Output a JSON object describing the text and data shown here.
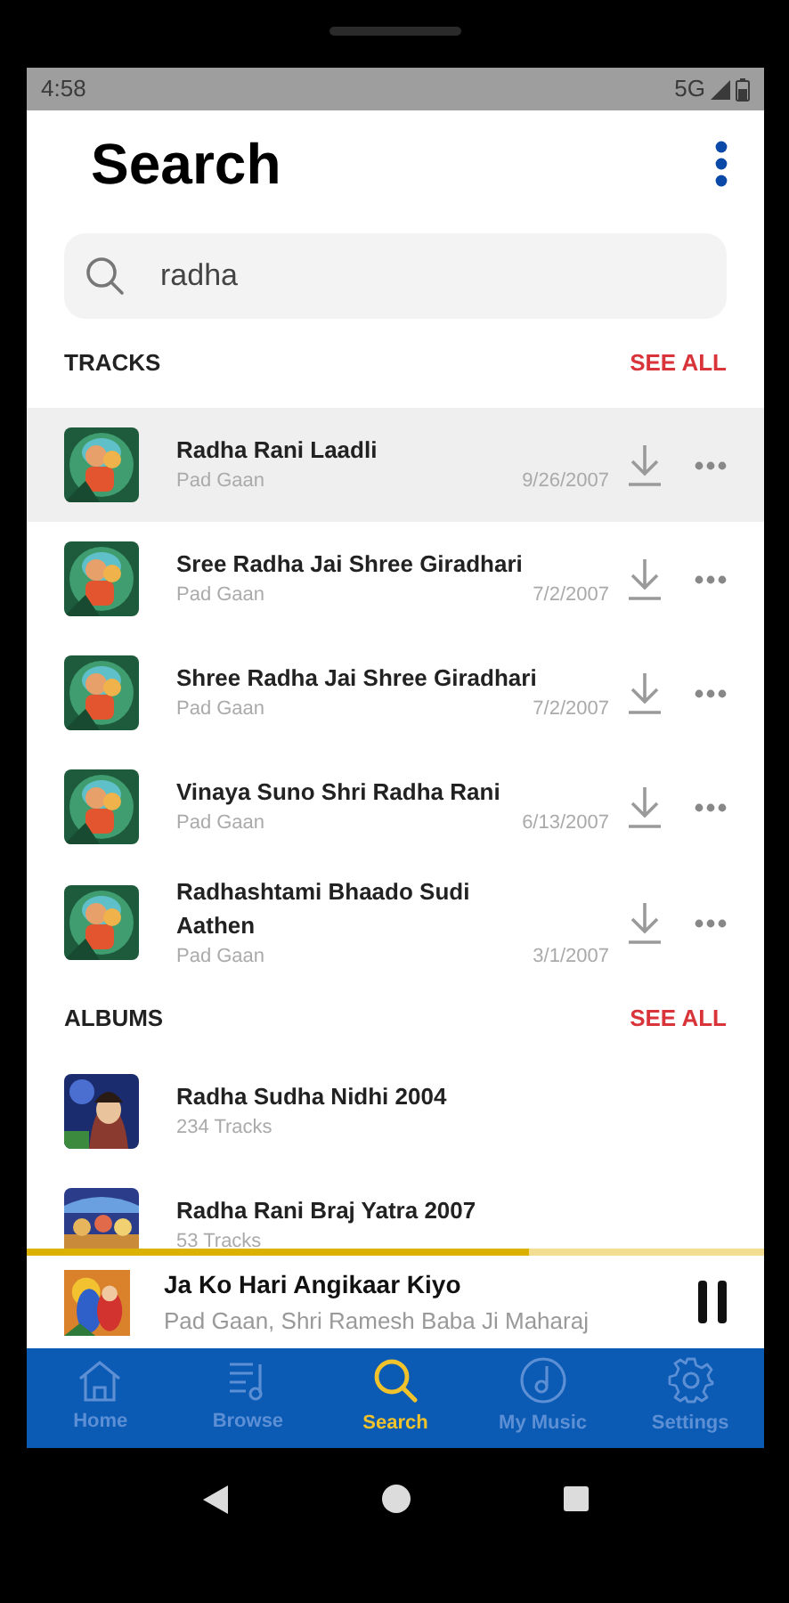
{
  "status_bar": {
    "time": "4:58",
    "network": "5G"
  },
  "header": {
    "title": "Search"
  },
  "search": {
    "value": "radha"
  },
  "tracks_section": {
    "title": "TRACKS",
    "see_all": "SEE ALL"
  },
  "tracks": [
    {
      "title": "Radha Rani Laadli",
      "subtitle": "Pad Gaan",
      "date": "9/26/2007",
      "selected": true
    },
    {
      "title": "Sree Radha Jai Shree Giradhari",
      "subtitle": "Pad Gaan",
      "date": "7/2/2007",
      "selected": false
    },
    {
      "title": "Shree Radha Jai Shree Giradhari",
      "subtitle": "Pad Gaan",
      "date": "7/2/2007",
      "selected": false
    },
    {
      "title": "Vinaya Suno Shri Radha Rani",
      "subtitle": "Pad Gaan",
      "date": "6/13/2007",
      "selected": false
    },
    {
      "title": "Radhashtami Bhaado Sudi Aathen",
      "subtitle": "Pad Gaan",
      "date": "3/1/2007",
      "selected": false
    }
  ],
  "albums_section": {
    "title": "ALBUMS",
    "see_all": "SEE ALL"
  },
  "albums": [
    {
      "title": "Radha Sudha Nidhi 2004",
      "subtitle": "234 Tracks"
    },
    {
      "title": "Radha Rani Braj Yatra 2007",
      "subtitle": "53 Tracks"
    }
  ],
  "now_playing": {
    "title": "Ja Ko Hari Angikaar Kiyo",
    "subtitle": "Pad Gaan, Shri Ramesh Baba Ji Maharaj",
    "level": 0.68,
    "playing": true
  },
  "tabs": [
    {
      "label": "Home",
      "selected": false
    },
    {
      "label": "Browse",
      "selected": false
    },
    {
      "label": "Search",
      "selected": true
    },
    {
      "label": "My Music",
      "selected": false
    },
    {
      "label": "Settings",
      "selected": false
    }
  ]
}
